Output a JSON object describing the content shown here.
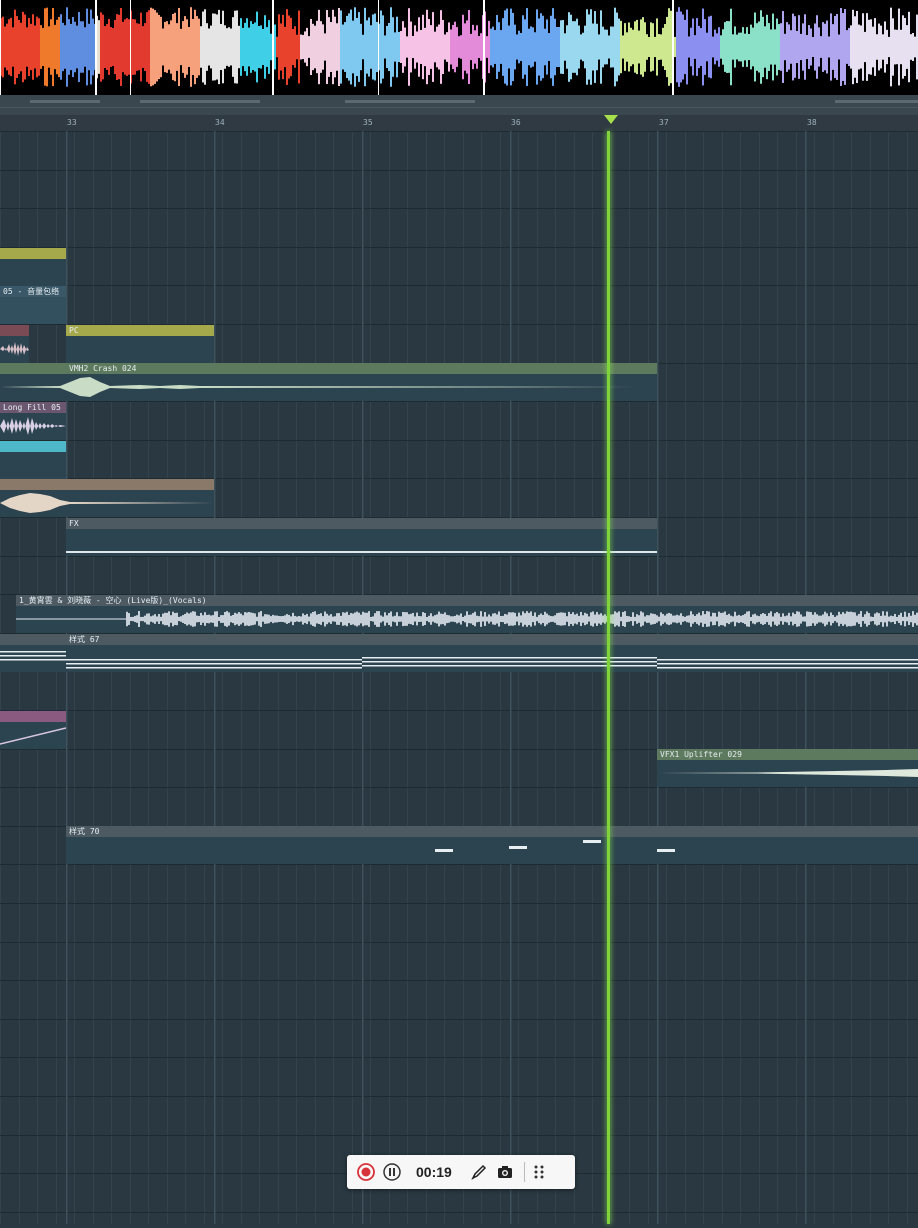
{
  "ruler": {
    "bars": [
      "33",
      "34",
      "35",
      "36",
      "37",
      "38"
    ]
  },
  "clips": {
    "volume_automation": "05 - 音量包络",
    "pc": "PC",
    "crash": "VMH2 Crash 024",
    "long_fill": "Long Fill 05",
    "fx": "FX",
    "vocals": "1_黄霄雲 & 刘晓薇 - 空心 (Live版)_(Vocals)",
    "pattern67": "样式 67",
    "uplifter": "VFX1 Uplifter 029",
    "pattern70": "样式 70"
  },
  "recorder": {
    "time": "00:19"
  },
  "colors": {
    "playhead": "#7fd43b",
    "grid_bg": "#2a3841",
    "clip_body": "#2c4350"
  }
}
